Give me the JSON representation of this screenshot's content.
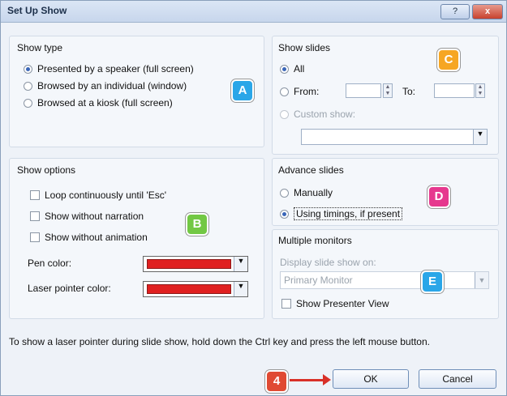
{
  "dialog": {
    "title": "Set Up Show",
    "help": "?",
    "close": "x"
  },
  "show_type": {
    "label": "Show type",
    "options": [
      {
        "text": "Presented by a speaker (full screen)"
      },
      {
        "text": "Browsed by an individual (window)"
      },
      {
        "text": "Browsed at a kiosk (full screen)"
      }
    ]
  },
  "show_slides": {
    "label": "Show slides",
    "all": "All",
    "from": "From:",
    "to": "To:",
    "custom": "Custom show:"
  },
  "show_options": {
    "label": "Show options",
    "loop": "Loop continuously until 'Esc'",
    "no_narration": "Show without narration",
    "no_animation": "Show without animation",
    "pen_color": "Pen color:",
    "laser_color": "Laser pointer color:"
  },
  "advance": {
    "label": "Advance slides",
    "manual": "Manually",
    "timings": "Using timings, if present"
  },
  "monitors": {
    "label": "Multiple monitors",
    "display_on": "Display slide show on:",
    "primary": "Primary Monitor",
    "presenter": "Show Presenter View"
  },
  "note": "To show a laser pointer during slide show, hold down the Ctrl key and press the left mouse button.",
  "buttons": {
    "ok": "OK",
    "cancel": "Cancel"
  },
  "callouts": {
    "a": "A",
    "b": "B",
    "c": "C",
    "d": "D",
    "e": "E",
    "step": "4"
  },
  "colors": {
    "pen": "#e02020",
    "laser": "#e02020",
    "badge_blue": "#2aa6e8",
    "badge_green": "#72c844",
    "badge_orange": "#f6a623",
    "badge_pink": "#e6388e",
    "badge_red": "#e04a33"
  },
  "icons": [
    "help-icon",
    "close-icon",
    "spin-up-icon",
    "spin-down-icon",
    "dropdown-icon"
  ]
}
